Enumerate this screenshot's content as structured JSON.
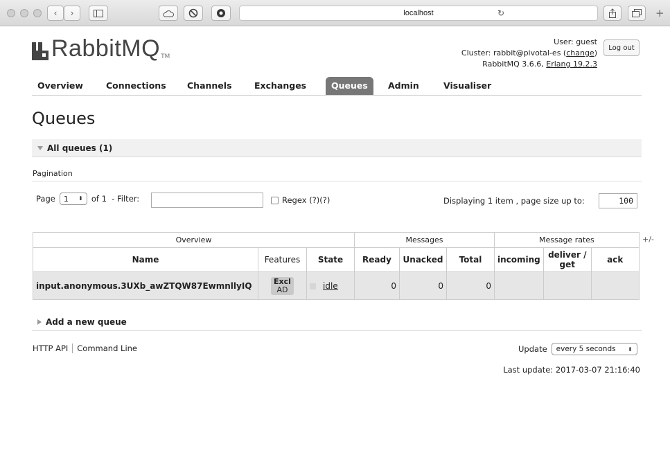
{
  "browser": {
    "address": "localhost",
    "icons": [
      "back-icon",
      "forward-icon",
      "sidebar-icon",
      "cloud-icon",
      "privacy-icon",
      "record-icon",
      "reload-icon",
      "share-icon",
      "tabs-icon",
      "new-tab-icon"
    ]
  },
  "header": {
    "logo_text": "RabbitMQ",
    "logo_tm": "TM",
    "user": "User: guest",
    "cluster_prefix": "Cluster: rabbit@pivotal-es (",
    "cluster_link": "change",
    "cluster_suffix": ")",
    "version_prefix": "RabbitMQ 3.6.6, ",
    "erlang": "Erlang 19.2.3",
    "logout": "Log out"
  },
  "nav": {
    "items": [
      "Overview",
      "Connections",
      "Channels",
      "Exchanges",
      "Queues",
      "Admin",
      "Visualiser"
    ],
    "active": "Queues"
  },
  "page": {
    "title": "Queues",
    "all_queues": "All queues (1)",
    "pagination_label": "Pagination",
    "page_label": "Page",
    "page_value": "1",
    "of_label": "of 1  - Filter:",
    "filter_value": "",
    "regex_label": "Regex",
    "regex_help": "(?)(?)",
    "displaying": "Displaying 1 item , page size up to:",
    "page_size": "100"
  },
  "table": {
    "group_headers": [
      "Overview",
      "Messages",
      "Message rates"
    ],
    "columns": [
      "Name",
      "Features",
      "State",
      "Ready",
      "Unacked",
      "Total",
      "incoming",
      "deliver / get",
      "ack"
    ],
    "plus_minus": "+/-",
    "rows": [
      {
        "name": "input.anonymous.3UXb_awZTQW87EwmnllyIQ",
        "features": [
          "Excl",
          "AD"
        ],
        "state": "idle",
        "ready": "0",
        "unacked": "0",
        "total": "0",
        "incoming": "",
        "deliver_get": "",
        "ack": ""
      }
    ]
  },
  "add_queue": "Add a new queue",
  "footer": {
    "http_api": "HTTP API",
    "command_line": "Command Line",
    "update_label": "Update",
    "update_value": "every 5 seconds",
    "last_update": "Last update: 2017-03-07 21:16:40"
  }
}
